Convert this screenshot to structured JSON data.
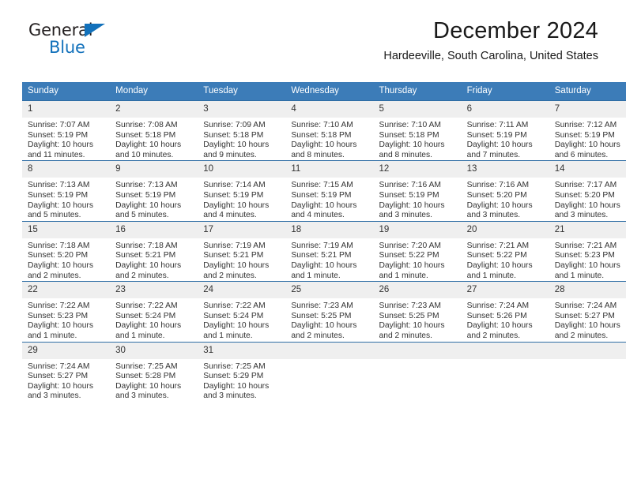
{
  "brand": {
    "line1": "General",
    "line2": "Blue",
    "triangle_color": "#1271bb",
    "text_color": "#231f20"
  },
  "header": {
    "title": "December 2024",
    "subtitle": "Hardeeville, South Carolina, United States"
  },
  "colors": {
    "header_bg": "#3c7cb8",
    "row_border": "#2e6da4",
    "daynum_bg": "#efefef",
    "text": "#333333"
  },
  "weekdays": [
    "Sunday",
    "Monday",
    "Tuesday",
    "Wednesday",
    "Thursday",
    "Friday",
    "Saturday"
  ],
  "weeks": [
    [
      {
        "day": "1",
        "sunrise": "Sunrise: 7:07 AM",
        "sunset": "Sunset: 5:19 PM",
        "daylight1": "Daylight: 10 hours",
        "daylight2": "and 11 minutes."
      },
      {
        "day": "2",
        "sunrise": "Sunrise: 7:08 AM",
        "sunset": "Sunset: 5:18 PM",
        "daylight1": "Daylight: 10 hours",
        "daylight2": "and 10 minutes."
      },
      {
        "day": "3",
        "sunrise": "Sunrise: 7:09 AM",
        "sunset": "Sunset: 5:18 PM",
        "daylight1": "Daylight: 10 hours",
        "daylight2": "and 9 minutes."
      },
      {
        "day": "4",
        "sunrise": "Sunrise: 7:10 AM",
        "sunset": "Sunset: 5:18 PM",
        "daylight1": "Daylight: 10 hours",
        "daylight2": "and 8 minutes."
      },
      {
        "day": "5",
        "sunrise": "Sunrise: 7:10 AM",
        "sunset": "Sunset: 5:18 PM",
        "daylight1": "Daylight: 10 hours",
        "daylight2": "and 8 minutes."
      },
      {
        "day": "6",
        "sunrise": "Sunrise: 7:11 AM",
        "sunset": "Sunset: 5:19 PM",
        "daylight1": "Daylight: 10 hours",
        "daylight2": "and 7 minutes."
      },
      {
        "day": "7",
        "sunrise": "Sunrise: 7:12 AM",
        "sunset": "Sunset: 5:19 PM",
        "daylight1": "Daylight: 10 hours",
        "daylight2": "and 6 minutes."
      }
    ],
    [
      {
        "day": "8",
        "sunrise": "Sunrise: 7:13 AM",
        "sunset": "Sunset: 5:19 PM",
        "daylight1": "Daylight: 10 hours",
        "daylight2": "and 5 minutes."
      },
      {
        "day": "9",
        "sunrise": "Sunrise: 7:13 AM",
        "sunset": "Sunset: 5:19 PM",
        "daylight1": "Daylight: 10 hours",
        "daylight2": "and 5 minutes."
      },
      {
        "day": "10",
        "sunrise": "Sunrise: 7:14 AM",
        "sunset": "Sunset: 5:19 PM",
        "daylight1": "Daylight: 10 hours",
        "daylight2": "and 4 minutes."
      },
      {
        "day": "11",
        "sunrise": "Sunrise: 7:15 AM",
        "sunset": "Sunset: 5:19 PM",
        "daylight1": "Daylight: 10 hours",
        "daylight2": "and 4 minutes."
      },
      {
        "day": "12",
        "sunrise": "Sunrise: 7:16 AM",
        "sunset": "Sunset: 5:19 PM",
        "daylight1": "Daylight: 10 hours",
        "daylight2": "and 3 minutes."
      },
      {
        "day": "13",
        "sunrise": "Sunrise: 7:16 AM",
        "sunset": "Sunset: 5:20 PM",
        "daylight1": "Daylight: 10 hours",
        "daylight2": "and 3 minutes."
      },
      {
        "day": "14",
        "sunrise": "Sunrise: 7:17 AM",
        "sunset": "Sunset: 5:20 PM",
        "daylight1": "Daylight: 10 hours",
        "daylight2": "and 3 minutes."
      }
    ],
    [
      {
        "day": "15",
        "sunrise": "Sunrise: 7:18 AM",
        "sunset": "Sunset: 5:20 PM",
        "daylight1": "Daylight: 10 hours",
        "daylight2": "and 2 minutes."
      },
      {
        "day": "16",
        "sunrise": "Sunrise: 7:18 AM",
        "sunset": "Sunset: 5:21 PM",
        "daylight1": "Daylight: 10 hours",
        "daylight2": "and 2 minutes."
      },
      {
        "day": "17",
        "sunrise": "Sunrise: 7:19 AM",
        "sunset": "Sunset: 5:21 PM",
        "daylight1": "Daylight: 10 hours",
        "daylight2": "and 2 minutes."
      },
      {
        "day": "18",
        "sunrise": "Sunrise: 7:19 AM",
        "sunset": "Sunset: 5:21 PM",
        "daylight1": "Daylight: 10 hours",
        "daylight2": "and 1 minute."
      },
      {
        "day": "19",
        "sunrise": "Sunrise: 7:20 AM",
        "sunset": "Sunset: 5:22 PM",
        "daylight1": "Daylight: 10 hours",
        "daylight2": "and 1 minute."
      },
      {
        "day": "20",
        "sunrise": "Sunrise: 7:21 AM",
        "sunset": "Sunset: 5:22 PM",
        "daylight1": "Daylight: 10 hours",
        "daylight2": "and 1 minute."
      },
      {
        "day": "21",
        "sunrise": "Sunrise: 7:21 AM",
        "sunset": "Sunset: 5:23 PM",
        "daylight1": "Daylight: 10 hours",
        "daylight2": "and 1 minute."
      }
    ],
    [
      {
        "day": "22",
        "sunrise": "Sunrise: 7:22 AM",
        "sunset": "Sunset: 5:23 PM",
        "daylight1": "Daylight: 10 hours",
        "daylight2": "and 1 minute."
      },
      {
        "day": "23",
        "sunrise": "Sunrise: 7:22 AM",
        "sunset": "Sunset: 5:24 PM",
        "daylight1": "Daylight: 10 hours",
        "daylight2": "and 1 minute."
      },
      {
        "day": "24",
        "sunrise": "Sunrise: 7:22 AM",
        "sunset": "Sunset: 5:24 PM",
        "daylight1": "Daylight: 10 hours",
        "daylight2": "and 1 minute."
      },
      {
        "day": "25",
        "sunrise": "Sunrise: 7:23 AM",
        "sunset": "Sunset: 5:25 PM",
        "daylight1": "Daylight: 10 hours",
        "daylight2": "and 2 minutes."
      },
      {
        "day": "26",
        "sunrise": "Sunrise: 7:23 AM",
        "sunset": "Sunset: 5:25 PM",
        "daylight1": "Daylight: 10 hours",
        "daylight2": "and 2 minutes."
      },
      {
        "day": "27",
        "sunrise": "Sunrise: 7:24 AM",
        "sunset": "Sunset: 5:26 PM",
        "daylight1": "Daylight: 10 hours",
        "daylight2": "and 2 minutes."
      },
      {
        "day": "28",
        "sunrise": "Sunrise: 7:24 AM",
        "sunset": "Sunset: 5:27 PM",
        "daylight1": "Daylight: 10 hours",
        "daylight2": "and 2 minutes."
      }
    ],
    [
      {
        "day": "29",
        "sunrise": "Sunrise: 7:24 AM",
        "sunset": "Sunset: 5:27 PM",
        "daylight1": "Daylight: 10 hours",
        "daylight2": "and 3 minutes."
      },
      {
        "day": "30",
        "sunrise": "Sunrise: 7:25 AM",
        "sunset": "Sunset: 5:28 PM",
        "daylight1": "Daylight: 10 hours",
        "daylight2": "and 3 minutes."
      },
      {
        "day": "31",
        "sunrise": "Sunrise: 7:25 AM",
        "sunset": "Sunset: 5:29 PM",
        "daylight1": "Daylight: 10 hours",
        "daylight2": "and 3 minutes."
      },
      {
        "day": "",
        "sunrise": "",
        "sunset": "",
        "daylight1": "",
        "daylight2": ""
      },
      {
        "day": "",
        "sunrise": "",
        "sunset": "",
        "daylight1": "",
        "daylight2": ""
      },
      {
        "day": "",
        "sunrise": "",
        "sunset": "",
        "daylight1": "",
        "daylight2": ""
      },
      {
        "day": "",
        "sunrise": "",
        "sunset": "",
        "daylight1": "",
        "daylight2": ""
      }
    ]
  ]
}
